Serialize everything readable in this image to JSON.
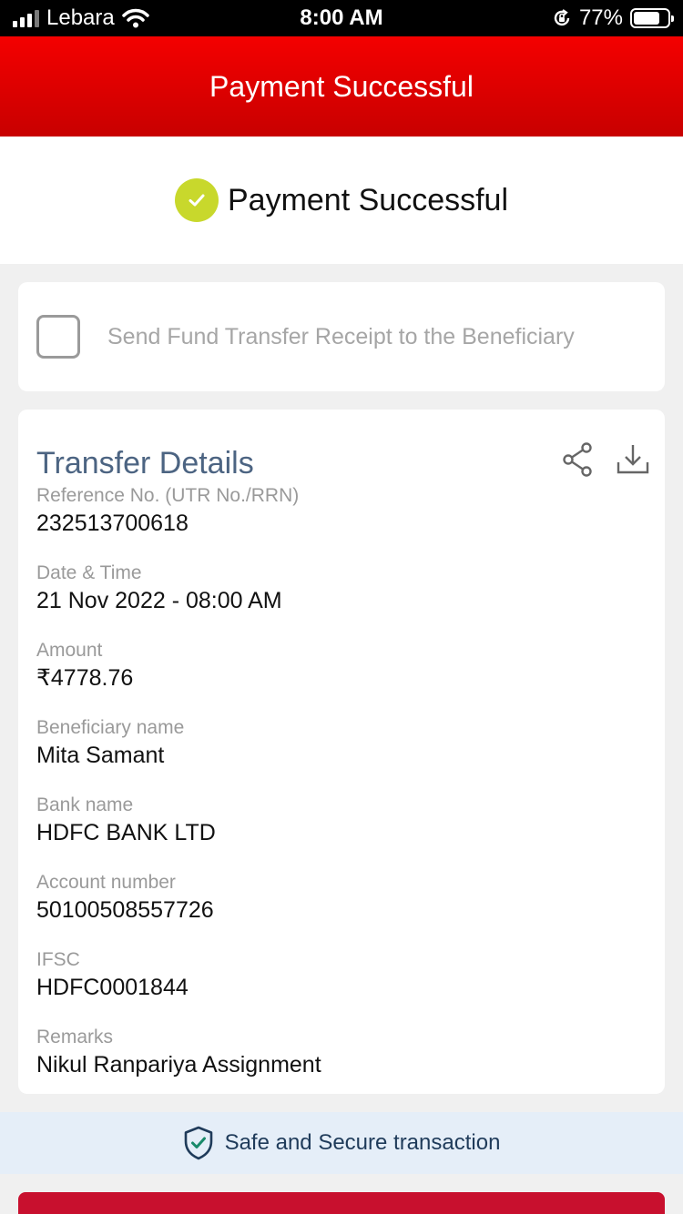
{
  "status_bar": {
    "carrier": "Lebara",
    "time": "8:00 AM",
    "battery": "77%",
    "battery_level": 0.77,
    "signal_bars": 3
  },
  "header": {
    "title": "Payment Successful"
  },
  "banner": {
    "text": "Payment Successful",
    "check_color": "#c8d82c"
  },
  "receipt": {
    "label": "Send Fund Transfer Receipt to the Beneficiary",
    "checked": false
  },
  "details": {
    "title": "Transfer Details",
    "actions": [
      "share-icon",
      "download-icon"
    ],
    "fields": [
      {
        "label": "Reference No. (UTR No./RRN)",
        "value": "232513700618"
      },
      {
        "label": "Date & Time",
        "value": "21 Nov 2022 - 08:00 AM"
      },
      {
        "label": "Amount",
        "value": "₹4778.76"
      },
      {
        "label": "Beneficiary name",
        "value": "Mita Samant"
      },
      {
        "label": "Bank name",
        "value": "HDFC BANK LTD"
      },
      {
        "label": "Account number",
        "value": "50100508557726"
      },
      {
        "label": "IFSC",
        "value": "HDFC0001844"
      },
      {
        "label": "Remarks",
        "value": "Nikul Ranpariya Assignment"
      }
    ]
  },
  "secure": {
    "text": "Safe and Secure transaction",
    "icon": "shield-check-icon"
  },
  "colors": {
    "brand_red": "#e00000",
    "title_blue": "#4c6482",
    "shield_green": "#1a8a6a"
  }
}
